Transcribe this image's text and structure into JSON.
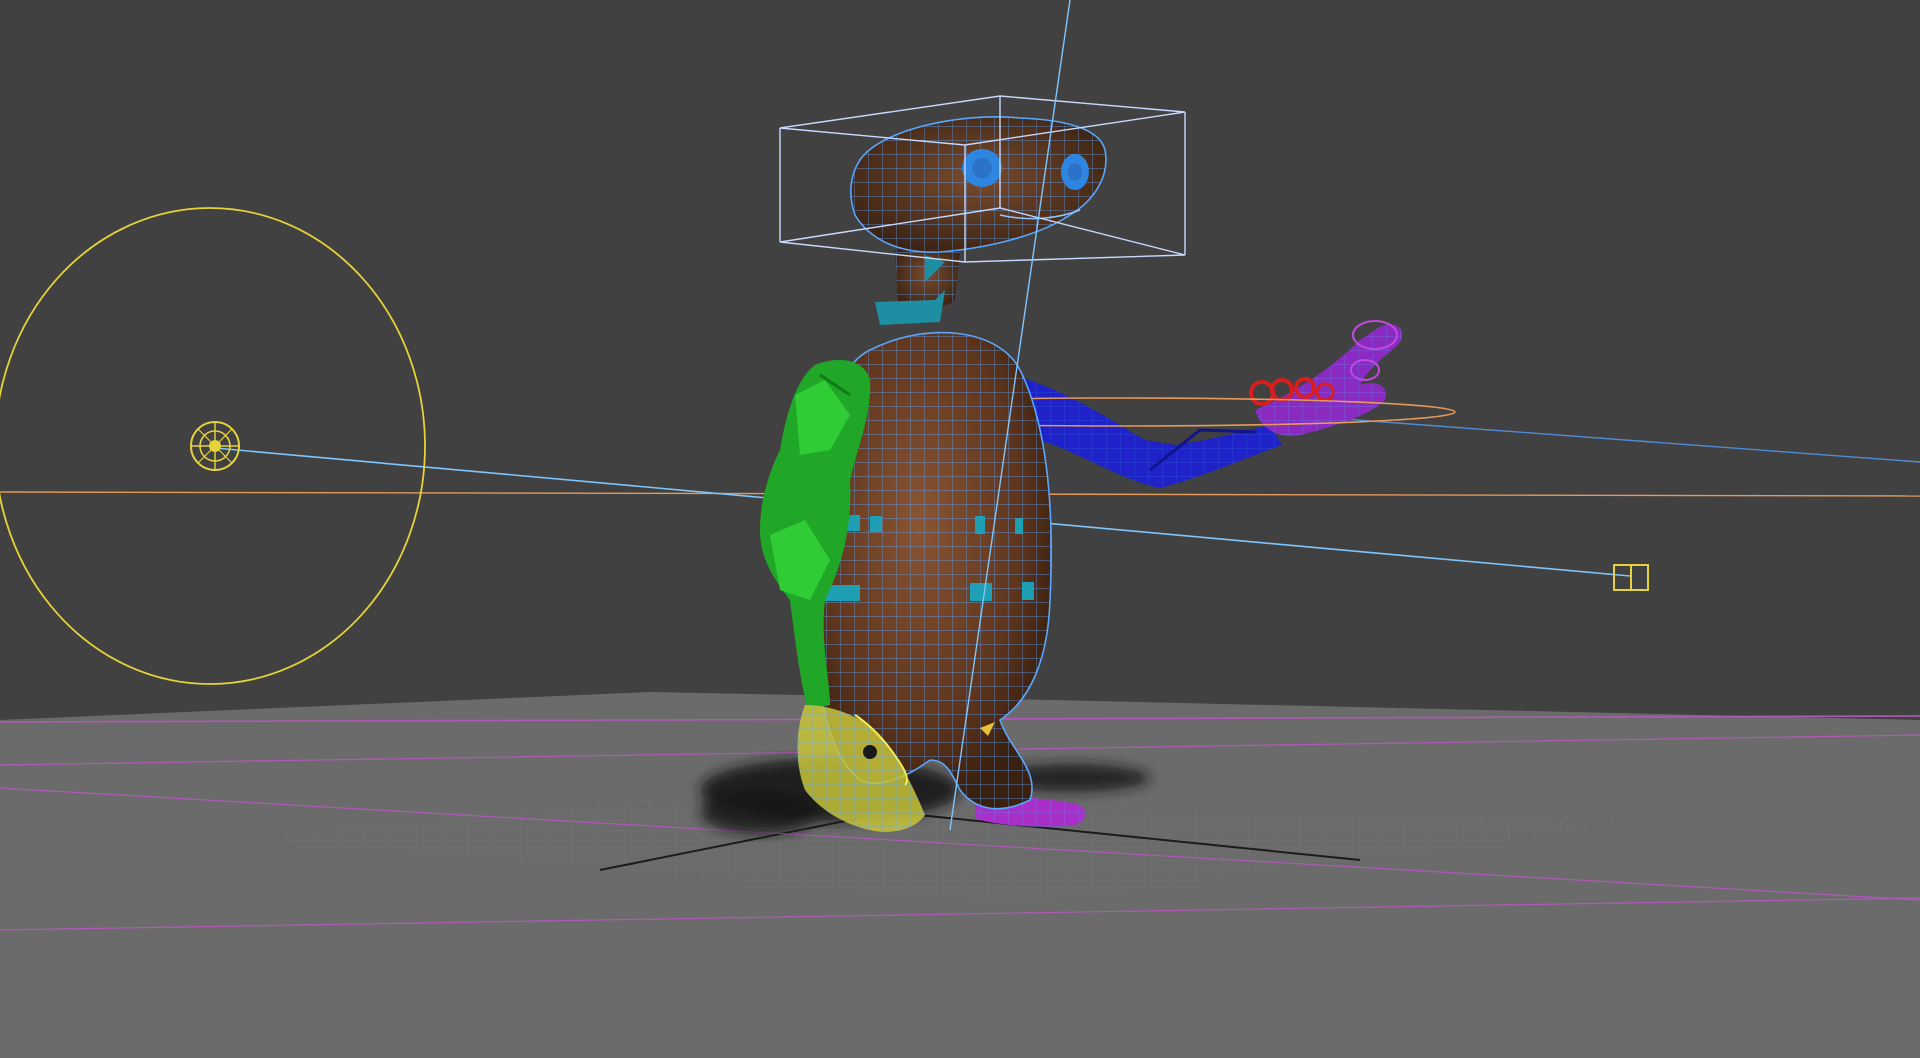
{
  "viewport": {
    "background_color": "#414141",
    "ground_color": "#6b6b6b",
    "ground_far_color": "#666666",
    "grid_color": "#7c7c7c",
    "horizon_line_color": "#b05ab8",
    "wire_color": "#5aa6ff",
    "light_color": "#e6d23a",
    "selection_ring_color": "#e59a5a",
    "scene_objects": {
      "character": "alien-character",
      "light": "spot-light",
      "camera_target": "target-helper",
      "head_gizmo": "bounding-box"
    },
    "rig_colors": {
      "body_skin": "#6b3e23",
      "left_arm": "#22b02a",
      "right_arm": "#1e22c8",
      "left_hand": "#d8d43a",
      "right_hand": "#9a2ad0",
      "fingertips": "#d81e1e",
      "controls": "#1e9fb3",
      "eyes": "#2f86e0",
      "feet": "#a830c8"
    }
  }
}
